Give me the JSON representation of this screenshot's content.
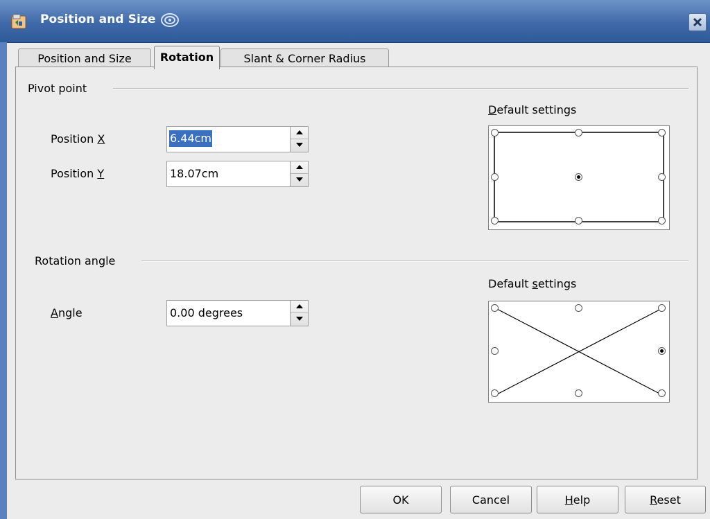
{
  "window": {
    "title": "Position and Size",
    "title_bar_color": "#3f69a8"
  },
  "tabs": [
    {
      "label": "Position and Size",
      "active": false
    },
    {
      "label": "Rotation",
      "active": true
    },
    {
      "label": "Slant & Corner Radius",
      "active": false
    }
  ],
  "pivot": {
    "section_title": "Pivot point",
    "position_x_label_prefix": "Position ",
    "position_x_label_key": "X",
    "position_x_value": "6.44cm",
    "position_y_label_prefix": "Position ",
    "position_y_label_key": "Y",
    "position_y_value": "18.07cm",
    "default_label_key": "D",
    "default_label_rest": "efault settings",
    "selected_point": "center"
  },
  "rotation": {
    "section_title": "Rotation angle",
    "angle_label_key": "A",
    "angle_label_rest": "ngle",
    "angle_value": "0.00 degrees",
    "default_label_prefix": "Default ",
    "default_label_key": "s",
    "default_label_rest": "ettings",
    "selected_point": "middle-right"
  },
  "buttons": {
    "ok": "OK",
    "cancel": "Cancel",
    "help_key": "H",
    "help_rest": "elp",
    "reset_key": "R",
    "reset_rest": "eset"
  },
  "icons": {
    "app": "app-icon",
    "swirl": "swirl-icon",
    "close": "close-icon",
    "spin_up": "arrow-up-icon",
    "spin_down": "arrow-down-icon"
  }
}
